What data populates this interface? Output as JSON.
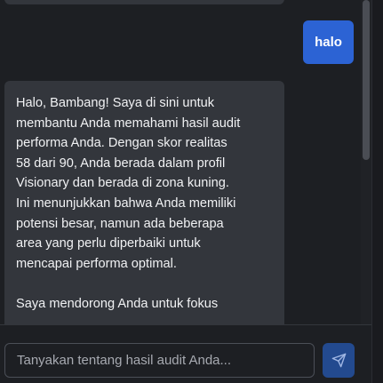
{
  "conversation": {
    "user_message": "halo",
    "assistant_message_paragraphs": [
      "Halo, Bambang! Saya di sini untuk\nmembantu Anda memahami hasil audit\nperforma Anda. Dengan skor realitas\n58 dari 90, Anda berada dalam profil\nVisionary dan berada di zona kuning.\nIni menunjukkan bahwa Anda memiliki\npotensi besar, namun ada beberapa\narea yang perlu diperbaiki untuk\nmencapai performa optimal.",
      "Saya mendorong Anda untuk fokus"
    ]
  },
  "composer": {
    "placeholder": "Tanyakan tentang hasil audit Anda...",
    "send_icon": "send-icon"
  },
  "colors": {
    "background": "#1d1f23",
    "assistant_bubble": "#33363c",
    "user_bubble": "#2c63d4",
    "send_button": "#234a8f"
  }
}
